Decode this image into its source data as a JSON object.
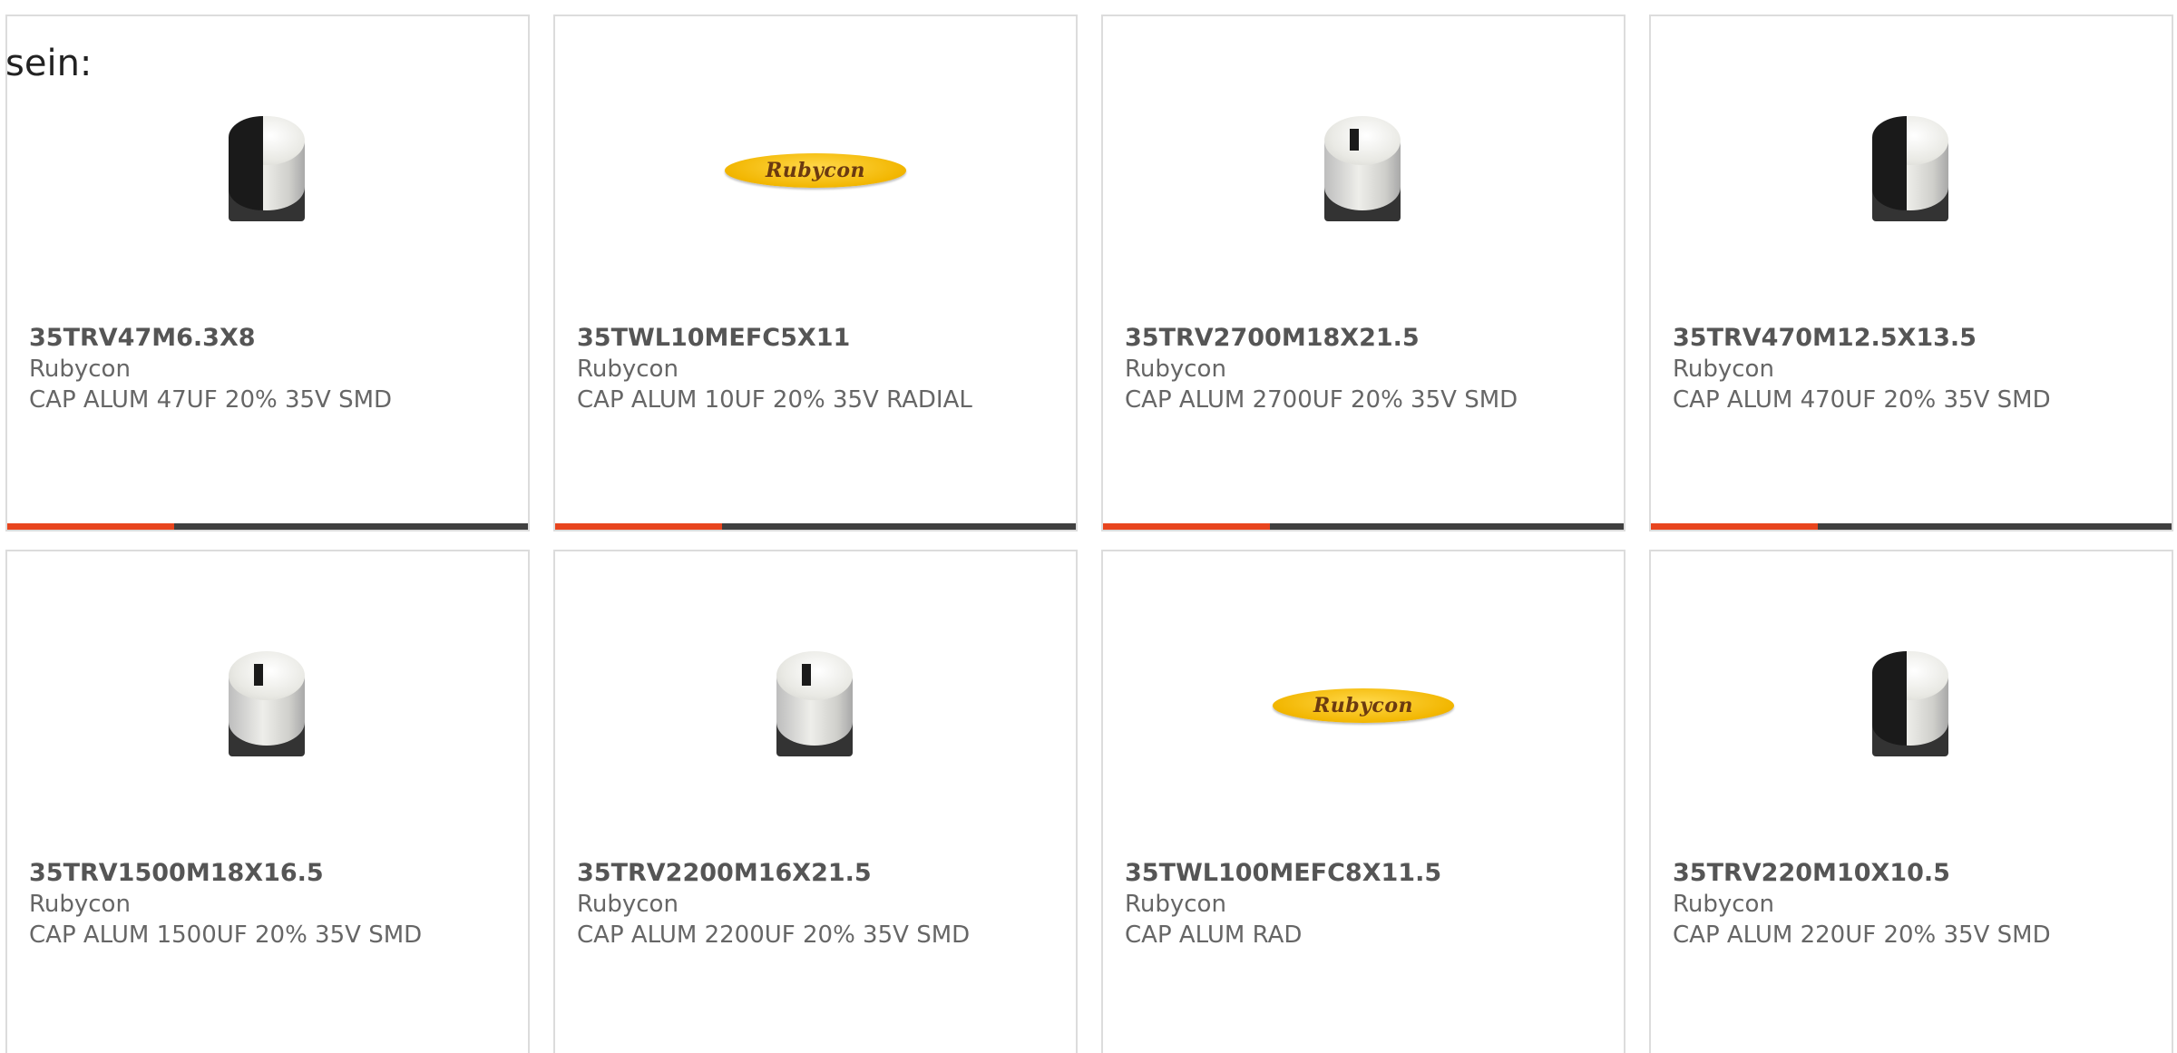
{
  "heading": "sein:",
  "accent_color": "#e8451e",
  "progress_fraction": 0.32,
  "products": [
    {
      "part": "35TRV47M6.3X8",
      "mfr": "Rubycon",
      "desc": "CAP ALUM 47UF 20% 35V SMD",
      "image": "capacitor-side-stripe-icon"
    },
    {
      "part": "35TWL10MEFC5X11",
      "mfr": "Rubycon",
      "desc": "CAP ALUM 10UF 20% 35V RADIAL",
      "image": "rubycon-logo",
      "logo_text": "Rubycon"
    },
    {
      "part": "35TRV2700M18X21.5",
      "mfr": "Rubycon",
      "desc": "CAP ALUM 2700UF 20% 35V SMD",
      "image": "capacitor-top-mark-icon"
    },
    {
      "part": "35TRV470M12.5X13.5",
      "mfr": "Rubycon",
      "desc": "CAP ALUM 470UF 20% 35V SMD",
      "image": "capacitor-side-stripe-icon"
    },
    {
      "part": "35TRV1500M18X16.5",
      "mfr": "Rubycon",
      "desc": "CAP ALUM 1500UF 20% 35V SMD",
      "image": "capacitor-top-mark-icon"
    },
    {
      "part": "35TRV2200M16X21.5",
      "mfr": "Rubycon",
      "desc": "CAP ALUM 2200UF 20% 35V SMD",
      "image": "capacitor-top-mark-icon"
    },
    {
      "part": "35TWL100MEFC8X11.5",
      "mfr": "Rubycon",
      "desc": "CAP ALUM RAD",
      "image": "rubycon-logo",
      "logo_text": "Rubycon"
    },
    {
      "part": "35TRV220M10X10.5",
      "mfr": "Rubycon",
      "desc": "CAP ALUM 220UF 20% 35V SMD",
      "image": "capacitor-side-stripe-icon"
    }
  ]
}
